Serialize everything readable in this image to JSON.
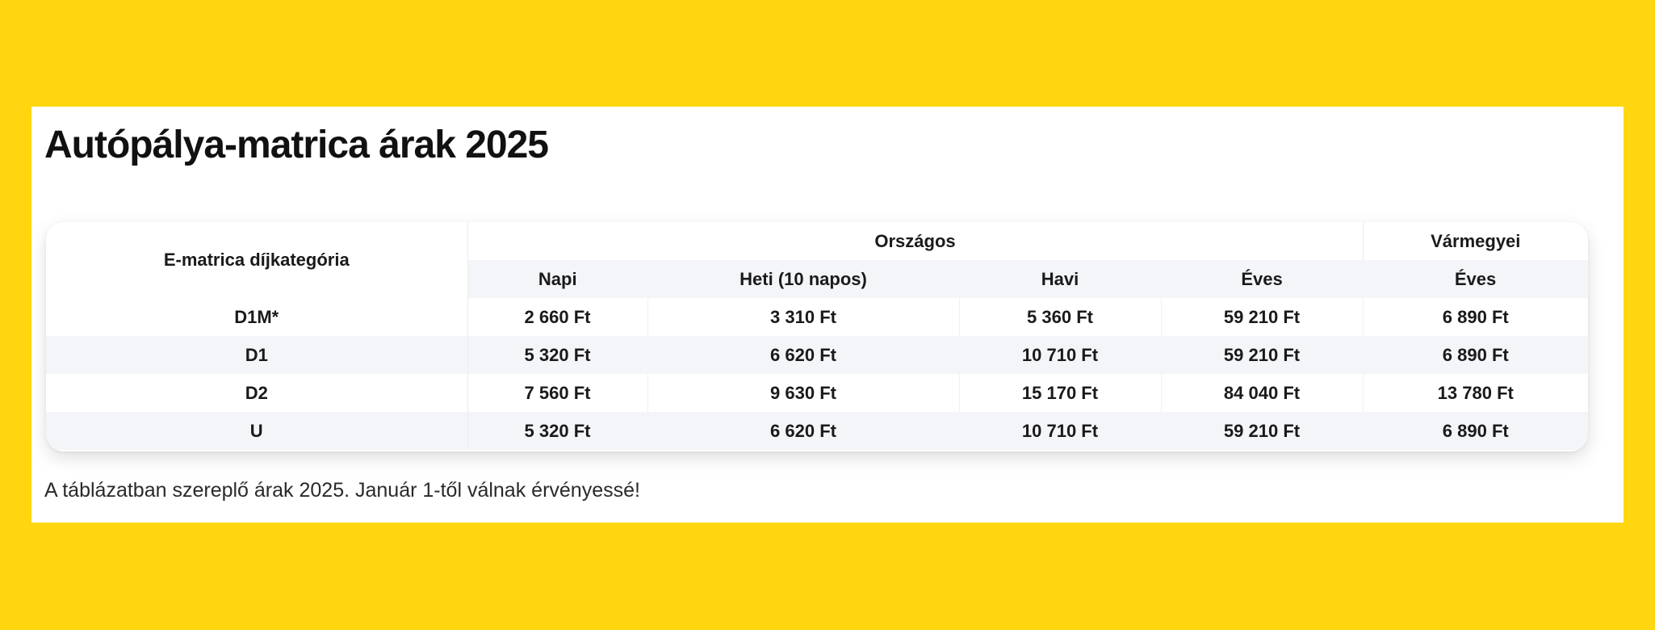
{
  "title": "Autópálya-matrica árak 2025",
  "table": {
    "category_header": "E-matrica díjkategória",
    "groups": {
      "national": "Országos",
      "regional": "Vármegyei"
    },
    "subheaders": [
      "Napi",
      "Heti (10 napos)",
      "Havi",
      "Éves",
      "Éves"
    ],
    "rows": [
      {
        "category": "D1M*",
        "values": [
          "2 660 Ft",
          "3 310 Ft",
          "5 360 Ft",
          "59 210 Ft",
          "6 890 Ft"
        ]
      },
      {
        "category": "D1",
        "values": [
          "5 320 Ft",
          "6 620 Ft",
          "10 710 Ft",
          "59 210 Ft",
          "6 890 Ft"
        ]
      },
      {
        "category": "D2",
        "values": [
          "7 560 Ft",
          "9 630 Ft",
          "15 170 Ft",
          "84 040 Ft",
          "13 780 Ft"
        ]
      },
      {
        "category": "U",
        "values": [
          "5 320 Ft",
          "6 620 Ft",
          "10 710 Ft",
          "59 210 Ft",
          "6 890 Ft"
        ]
      }
    ]
  },
  "note": "A táblázatban szereplő árak 2025. Január 1-től válnak érvényessé!",
  "colors": {
    "background": "#FFD60F",
    "card": "#FFFFFF",
    "stripe": "#F4F5F8",
    "text": "#1A1A1A"
  }
}
